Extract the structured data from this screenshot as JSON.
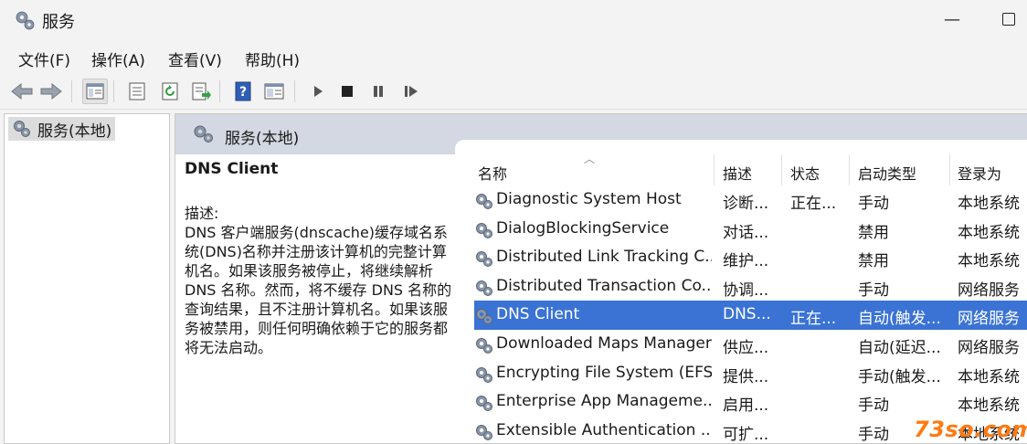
{
  "window": {
    "title": "服务"
  },
  "menu": [
    "文件(F)",
    "操作(A)",
    "查看(V)",
    "帮助(H)"
  ],
  "tree": {
    "root_label": "服务(本地)"
  },
  "panel": {
    "header_title": "服务(本地)",
    "selected_service": "DNS Client",
    "desc_label": "描述:",
    "desc_text": "DNS 客户端服务(dnscache)缓存域名系统(DNS)名称并注册该计算机的完整计算机名。如果该服务被停止，将继续解析 DNS 名称。然而，将不缓存 DNS 名称的查询结果，且不注册计算机名。如果该服务被禁用，则任何明确依赖于它的服务都将无法启动。"
  },
  "columns": [
    "名称",
    "描述",
    "状态",
    "启动类型",
    "登录为"
  ],
  "services": [
    {
      "name": "Diagnostic System Host",
      "desc": "诊断...",
      "state": "正在...",
      "startup": "手动",
      "logon": "本地系统"
    },
    {
      "name": "DialogBlockingService",
      "desc": "对话...",
      "state": "",
      "startup": "禁用",
      "logon": "本地系统"
    },
    {
      "name": "Distributed Link Tracking C...",
      "desc": "维护...",
      "state": "",
      "startup": "禁用",
      "logon": "本地系统"
    },
    {
      "name": "Distributed Transaction Co...",
      "desc": "协调...",
      "state": "",
      "startup": "手动",
      "logon": "网络服务"
    },
    {
      "name": "DNS Client",
      "desc": "DNS...",
      "state": "正在...",
      "startup": "自动(触发...",
      "logon": "网络服务"
    },
    {
      "name": "Downloaded Maps Manager",
      "desc": "供应...",
      "state": "",
      "startup": "自动(延迟...",
      "logon": "网络服务"
    },
    {
      "name": "Encrypting File System (EFS)",
      "desc": "提供...",
      "state": "",
      "startup": "手动(触发...",
      "logon": "本地系统"
    },
    {
      "name": "Enterprise App Manageme...",
      "desc": "启用...",
      "state": "",
      "startup": "手动",
      "logon": "本地系统"
    },
    {
      "name": "Extensible Authentication ...",
      "desc": "可扩...",
      "state": "",
      "startup": "手动",
      "logon": "本地系统"
    }
  ],
  "selected_index": 4,
  "watermark": "73so.com",
  "colors": {
    "selection": "#3a73d4",
    "header_band": "#d4d8e3",
    "watermark": "#ff7a12"
  }
}
